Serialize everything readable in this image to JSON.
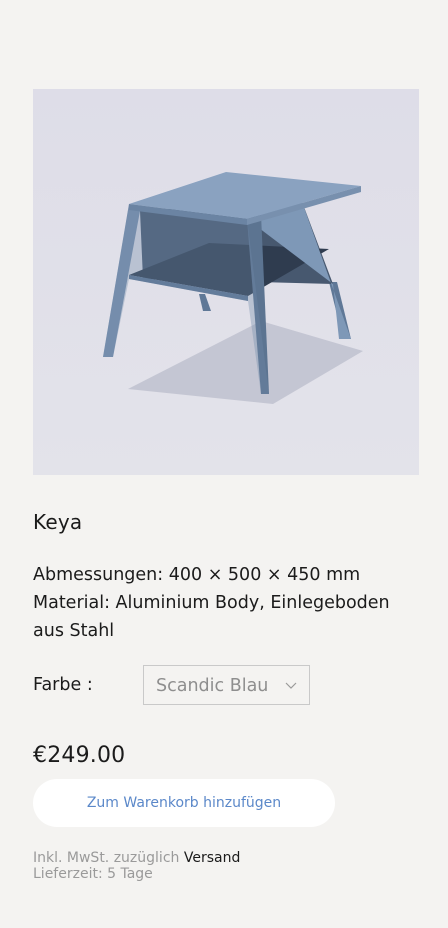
{
  "product": {
    "image_alt": "side-table-photo",
    "name": "Keya",
    "dimensions": "Abmessungen: 400 × 500 × 450 mm",
    "material_line1": "Material: Aluminium Body, Einlegeboden",
    "material_line2": "aus Stahl",
    "price": "€249.00"
  },
  "color": {
    "label": "Farbe :",
    "selected": "Scandic Blau"
  },
  "cart": {
    "button_label": "Zum Warenkorb hinzufügen"
  },
  "info": {
    "tax_text": "Inkl. MwSt. zuzüglich ",
    "shipping_link": "Versand",
    "delivery": "Lieferzeit: 5 Tage"
  },
  "colors": {
    "background": "#f4f3f1",
    "accent": "#5b88c9",
    "table": "#7d96b3"
  }
}
